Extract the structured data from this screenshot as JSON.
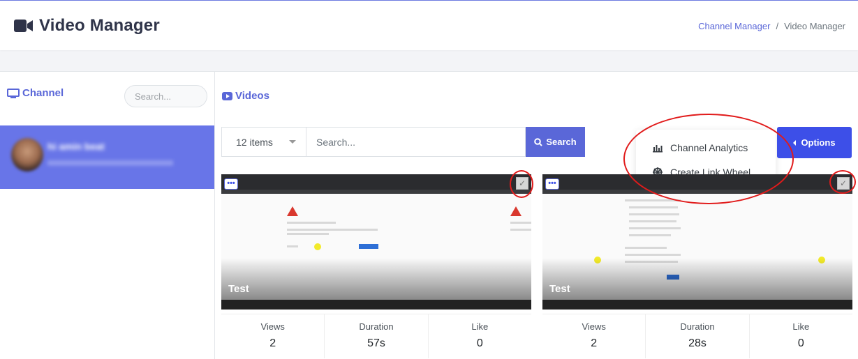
{
  "header": {
    "title": "Video Manager",
    "breadcrumb": {
      "link": "Channel Manager",
      "separator": "/",
      "current": "Video Manager"
    }
  },
  "sidebar": {
    "heading": "Channel",
    "search_placeholder": "Search...",
    "channel": {
      "name": "hi amin beat",
      "email": "xxxxxxxxxxxxxxxxxxxxxxxxxxxxxx"
    }
  },
  "main": {
    "heading": "Videos",
    "items_select": "12 items",
    "search_placeholder": "Search...",
    "search_button": "Search",
    "options_button": "Options",
    "dropdown": [
      {
        "label": "Channel Analytics",
        "icon": "bar-chart-icon"
      },
      {
        "label": "Create Link Wheel",
        "icon": "dharma-wheel-icon"
      }
    ]
  },
  "videos": [
    {
      "title": "Test",
      "stats": {
        "views_label": "Views",
        "views": "2",
        "duration_label": "Duration",
        "duration": "57s",
        "like_label": "Like",
        "like": "0"
      }
    },
    {
      "title": "Test",
      "stats": {
        "views_label": "Views",
        "views": "2",
        "duration_label": "Duration",
        "duration": "28s",
        "like_label": "Like",
        "like": "0"
      }
    }
  ],
  "colors": {
    "accent": "#5a67d8",
    "options": "#3d4fe8",
    "selected_row": "#6875e8",
    "annotation": "#e11b1b"
  }
}
